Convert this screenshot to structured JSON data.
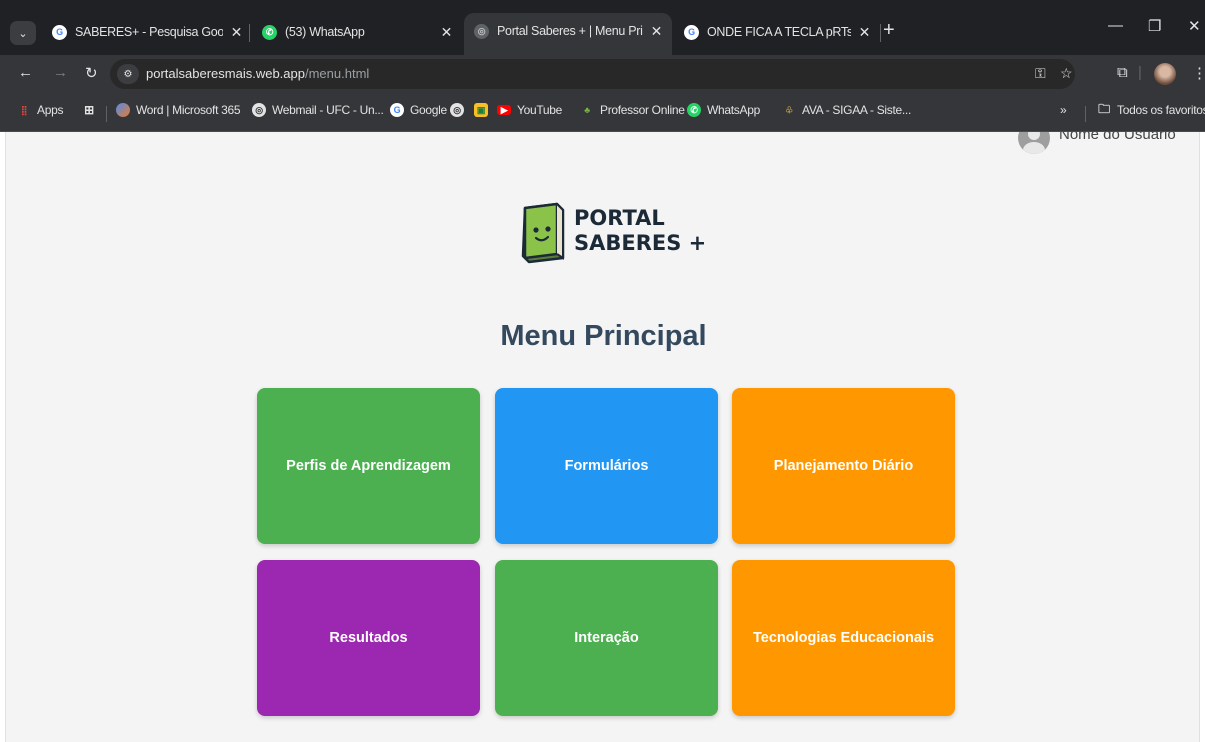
{
  "browser": {
    "tabs": [
      {
        "title": "SABERES+ - Pesquisa Google",
        "icon": "google-icon",
        "active": false
      },
      {
        "title": "(53) WhatsApp",
        "icon": "whatsapp-icon",
        "active": false
      },
      {
        "title": "Portal Saberes + | Menu Princip",
        "icon": "globe-icon",
        "active": true
      },
      {
        "title": "ONDE FICA A TECLA pRTsCN - I",
        "icon": "google-icon",
        "active": false
      }
    ],
    "new_tab_label": "+",
    "url_domain": "portalsaberesmais.web.app",
    "url_path": "/menu.html",
    "bookmarks": [
      {
        "label": "Apps",
        "icon": "apps-grid-icon"
      },
      {
        "label": "",
        "icon": "grid-icon"
      },
      {
        "label": "Word | Microsoft 365",
        "icon": "microsoft-365-icon"
      },
      {
        "label": "Webmail - UFC - Un...",
        "icon": "globe-icon"
      },
      {
        "label": "Google",
        "icon": "google-icon"
      },
      {
        "label": "",
        "icon": "globe-icon"
      },
      {
        "label": "",
        "icon": "photo-icon"
      },
      {
        "label": "YouTube",
        "icon": "youtube-icon"
      },
      {
        "label": "Professor Online",
        "icon": "professor-icon"
      },
      {
        "label": "WhatsApp",
        "icon": "whatsapp-icon"
      },
      {
        "label": "AVA - SIGAA - Siste...",
        "icon": "sigaa-icon"
      }
    ],
    "more_bookmarks": "»",
    "all_bookmarks": "Todos os favoritos"
  },
  "page": {
    "user_name": "Nome do Usuário",
    "logo_line1": "PORTAL",
    "logo_line2": "SABERES +",
    "title": "Menu Principal",
    "cards": [
      {
        "label": "Perfis de Aprendizagem",
        "color": "#4caf50"
      },
      {
        "label": "Formulários",
        "color": "#2196f3"
      },
      {
        "label": "Planejamento Diário",
        "color": "#ff9800"
      },
      {
        "label": "Resultados",
        "color": "#9c27b0"
      },
      {
        "label": "Interação",
        "color": "#4caf50"
      },
      {
        "label": "Tecnologias Educacionais",
        "color": "#ff9800"
      }
    ]
  },
  "colors": {
    "chrome_dark": "#202124",
    "toolbar": "#35363a",
    "page_bg": "#f4f4f4",
    "title_text": "#34495e"
  }
}
